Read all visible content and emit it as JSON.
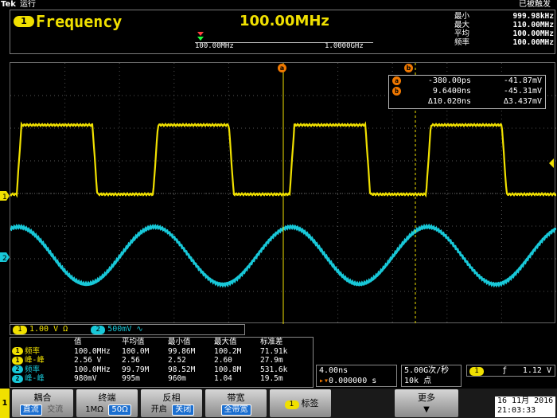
{
  "topbar": {
    "brand": "Tek",
    "run_state": "运行",
    "trigger_status": "已被触发"
  },
  "frequency_panel": {
    "badge": "1",
    "title": "Frequency",
    "value": "100.00MHz",
    "scale_min": "100.00MHz",
    "scale_max": "1.0000GHz",
    "stats": [
      {
        "label": "最小",
        "value": "999.98kHz"
      },
      {
        "label": "最大",
        "value": "110.00MHz"
      },
      {
        "label": "平均",
        "value": "100.00MHz"
      },
      {
        "label": "频率",
        "value": "100.00MHz"
      }
    ]
  },
  "cursors": {
    "a_label": "a",
    "b_label": "b",
    "rows": [
      {
        "badge": "a",
        "time": "-380.00ps",
        "volt": "-41.87mV"
      },
      {
        "badge": "b",
        "time": "9.6400ns",
        "volt": "-45.31mV"
      },
      {
        "badge": "",
        "time": "Δ10.020ns",
        "volt": "Δ3.437mV"
      }
    ]
  },
  "channels": {
    "ch1": {
      "tag": "1",
      "scale": "1.00 V",
      "coupling_symbol": "Ω",
      "color": "#f0e000"
    },
    "ch2": {
      "tag": "2",
      "scale": "500mV",
      "coupling_symbol": "∿",
      "color": "#18c8d8"
    }
  },
  "measurements": {
    "headers": [
      "",
      "值",
      "平均值",
      "最小值",
      "最大值",
      "标准差"
    ],
    "rows": [
      {
        "ch": "1",
        "name": "频率",
        "color": "#f0e000",
        "cells": [
          "100.0MHz",
          "100.0M",
          "99.86M",
          "100.2M",
          "71.91k"
        ]
      },
      {
        "ch": "1",
        "name": "峰-峰",
        "color": "#f0e000",
        "cells": [
          "2.56 V",
          "2.56",
          "2.52",
          "2.60",
          "27.9m"
        ]
      },
      {
        "ch": "2",
        "name": "频率",
        "color": "#18c8d8",
        "cells": [
          "100.0MHz",
          "99.79M",
          "98.52M",
          "100.8M",
          "531.6k"
        ]
      },
      {
        "ch": "2",
        "name": "峰-峰",
        "color": "#18c8d8",
        "cells": [
          "980mV",
          "995m",
          "960m",
          "1.04",
          "19.5m"
        ]
      }
    ]
  },
  "timebase": {
    "per_div": "4.00ns",
    "position": "0.000000 s",
    "sample_rate": "5.00G次/秒",
    "record_length": "10k 点"
  },
  "trigger": {
    "source": "1",
    "slope_symbol": "ƒ",
    "level": "1.12 V"
  },
  "menu": {
    "side_tag": "1",
    "coupling": {
      "title": "耦合",
      "opt1": "直流",
      "opt2": "交流"
    },
    "termination": {
      "title": "终端",
      "opt1": "1MΩ",
      "opt2": "50Ω"
    },
    "invert": {
      "title": "反相",
      "opt1": "开启",
      "opt2": "关闭"
    },
    "bandwidth": {
      "title": "带宽",
      "opt1": "全带宽"
    },
    "label": {
      "badge": "1",
      "title": "标签"
    },
    "more": {
      "title": "更多"
    }
  },
  "datetime": {
    "date": "16 11月 2016",
    "time": "21:03:33"
  }
}
